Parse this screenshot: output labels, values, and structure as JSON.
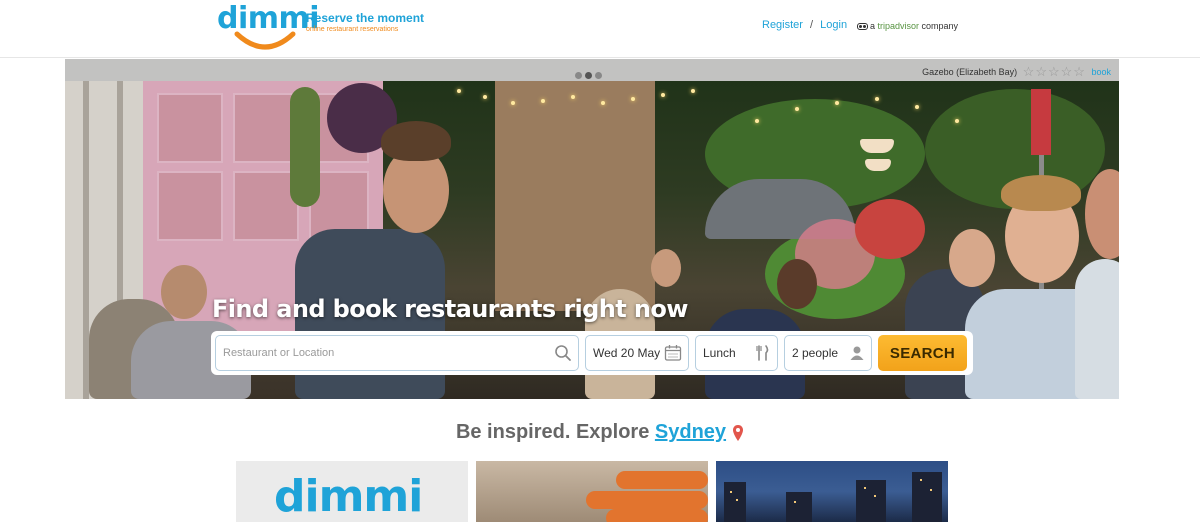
{
  "header": {
    "brand": "dimmi",
    "tagline": "Reserve the moment",
    "subtagline": "online restaurant reservations",
    "register_label": "Register",
    "separator": "/",
    "login_label": "Login",
    "company_prefix": "a ",
    "company_name": "tripadvisor",
    "company_suffix": " company"
  },
  "hero": {
    "carousel_dots": 3,
    "active_dot": 2,
    "venue_name": "Gazebo (Elizabeth Bay)",
    "rating_stars": "☆☆☆☆☆",
    "book_label": "book",
    "headline": "Find and book restaurants right now"
  },
  "search": {
    "location_placeholder": "Restaurant or Location",
    "date_value": "Wed 20 May",
    "meal_value": "Lunch",
    "people_value": "2 people",
    "button_label": "SEARCH"
  },
  "explore": {
    "prefix": "Be inspired. Explore ",
    "city": "Sydney"
  },
  "tiles": {
    "tile1_brand": "dimmi"
  },
  "colors": {
    "brand_blue": "#1fa3d8",
    "brand_orange": "#f08a1c",
    "search_button": "#f2a21a"
  }
}
